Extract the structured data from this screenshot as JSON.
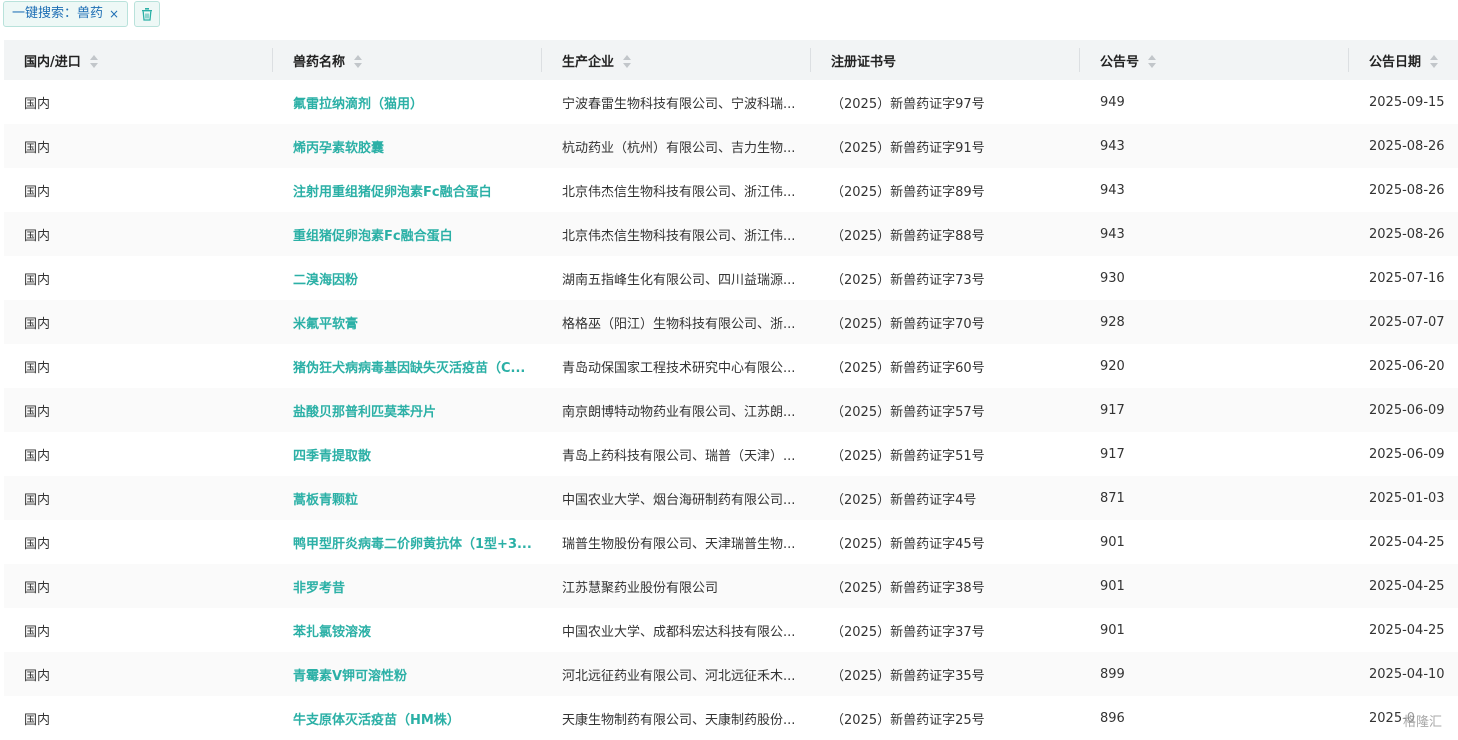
{
  "filter": {
    "chip_label": "一键搜索：兽药",
    "close_glyph": "×"
  },
  "table": {
    "headers": [
      "国内/进口",
      "兽药名称",
      "生产企业",
      "注册证书号",
      "公告号",
      "公告日期"
    ],
    "rows": [
      [
        "国内",
        "氟雷拉纳滴剂（猫用）",
        "宁波春雷生物科技有限公司、宁波科瑞...",
        "（2025）新兽药证字97号",
        "949",
        "2025-09-15"
      ],
      [
        "国内",
        "烯丙孕素软胶囊",
        "杭动药业（杭州）有限公司、吉力生物...",
        "（2025）新兽药证字91号",
        "943",
        "2025-08-26"
      ],
      [
        "国内",
        "注射用重组猪促卵泡素Fc融合蛋白",
        "北京伟杰信生物科技有限公司、浙江伟...",
        "（2025）新兽药证字89号",
        "943",
        "2025-08-26"
      ],
      [
        "国内",
        "重组猪促卵泡素Fc融合蛋白",
        "北京伟杰信生物科技有限公司、浙江伟...",
        "（2025）新兽药证字88号",
        "943",
        "2025-08-26"
      ],
      [
        "国内",
        "二溴海因粉",
        "湖南五指峰生化有限公司、四川益瑞源...",
        "（2025）新兽药证字73号",
        "930",
        "2025-07-16"
      ],
      [
        "国内",
        "米氟平软膏",
        "格格巫（阳江）生物科技有限公司、浙...",
        "（2025）新兽药证字70号",
        "928",
        "2025-07-07"
      ],
      [
        "国内",
        "猪伪狂犬病病毒基因缺失灭活疫苗（C...",
        "青岛动保国家工程技术研究中心有限公...",
        "（2025）新兽药证字60号",
        "920",
        "2025-06-20"
      ],
      [
        "国内",
        "盐酸贝那普利匹莫苯丹片",
        "南京朗博特动物药业有限公司、江苏朗...",
        "（2025）新兽药证字57号",
        "917",
        "2025-06-09"
      ],
      [
        "国内",
        "四季青提取散",
        "青岛上药科技有限公司、瑞普（天津）...",
        "（2025）新兽药证字51号",
        "917",
        "2025-06-09"
      ],
      [
        "国内",
        "蒿板青颗粒",
        "中国农业大学、烟台海研制药有限公司...",
        "（2025）新兽药证字4号",
        "871",
        "2025-01-03"
      ],
      [
        "国内",
        "鸭甲型肝炎病毒二价卵黄抗体（1型+3...",
        "瑞普生物股份有限公司、天津瑞普生物...",
        "（2025）新兽药证字45号",
        "901",
        "2025-04-25"
      ],
      [
        "国内",
        "非罗考昔",
        "江苏慧聚药业股份有限公司",
        "（2025）新兽药证字38号",
        "901",
        "2025-04-25"
      ],
      [
        "国内",
        "苯扎氯铵溶液",
        "中国农业大学、成都科宏达科技有限公...",
        "（2025）新兽药证字37号",
        "901",
        "2025-04-25"
      ],
      [
        "国内",
        "青霉素V钾可溶性粉",
        "河北远征药业有限公司、河北远征禾木...",
        "（2025）新兽药证字35号",
        "899",
        "2025-04-10"
      ],
      [
        "国内",
        "牛支原体灭活疫苗（HM株）",
        "天康生物制药有限公司、天康制药股份...",
        "（2025）新兽药证字25号",
        "896",
        "2025-0"
      ]
    ]
  },
  "watermark": "格隆汇",
  "colors": {
    "accent": "#2bb0a6",
    "chip_text": "#1f6fb5"
  },
  "icons": {
    "trash": "trash-icon",
    "sort": "sort-icon",
    "close": "close-icon"
  }
}
